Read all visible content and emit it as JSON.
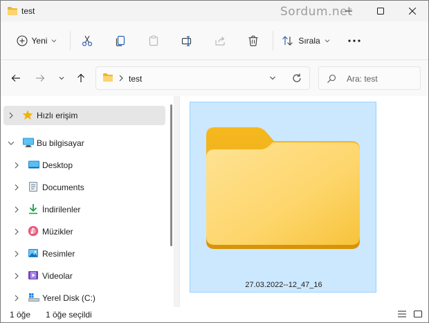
{
  "window": {
    "title": "test",
    "watermark": "Sordum.net"
  },
  "toolbar": {
    "new_label": "Yeni",
    "sort_label": "Sırala",
    "icons": [
      "plus-circle-icon",
      "scissors-icon",
      "copy-icon",
      "paste-icon",
      "rename-icon",
      "share-icon",
      "delete-icon",
      "sort-icon",
      "more-icon"
    ]
  },
  "address": {
    "path": "test",
    "search_placeholder": "Ara: test"
  },
  "sidebar": {
    "items": [
      {
        "label": "Hızlı erişim",
        "icon": "star-icon"
      },
      {
        "label": "Bu bilgisayar",
        "icon": "monitor-icon"
      },
      {
        "label": "Desktop",
        "icon": "desktop-icon"
      },
      {
        "label": "Documents",
        "icon": "documents-icon"
      },
      {
        "label": "İndirilenler",
        "icon": "download-icon"
      },
      {
        "label": "Müzikler",
        "icon": "music-icon"
      },
      {
        "label": "Resimler",
        "icon": "pictures-icon"
      },
      {
        "label": "Videolar",
        "icon": "videos-icon"
      },
      {
        "label": "Yerel Disk (C:)",
        "icon": "disk-icon"
      }
    ]
  },
  "content": {
    "items": [
      {
        "name": "27.03.2022--12_47_16",
        "icon": "folder-icon",
        "selected": true
      }
    ]
  },
  "status": {
    "count": "1 öğe",
    "selected": "1 öğe seçildi"
  },
  "colors": {
    "selection": "#cce8ff",
    "folder": "#f8c53a",
    "accent": "#0067c0"
  }
}
